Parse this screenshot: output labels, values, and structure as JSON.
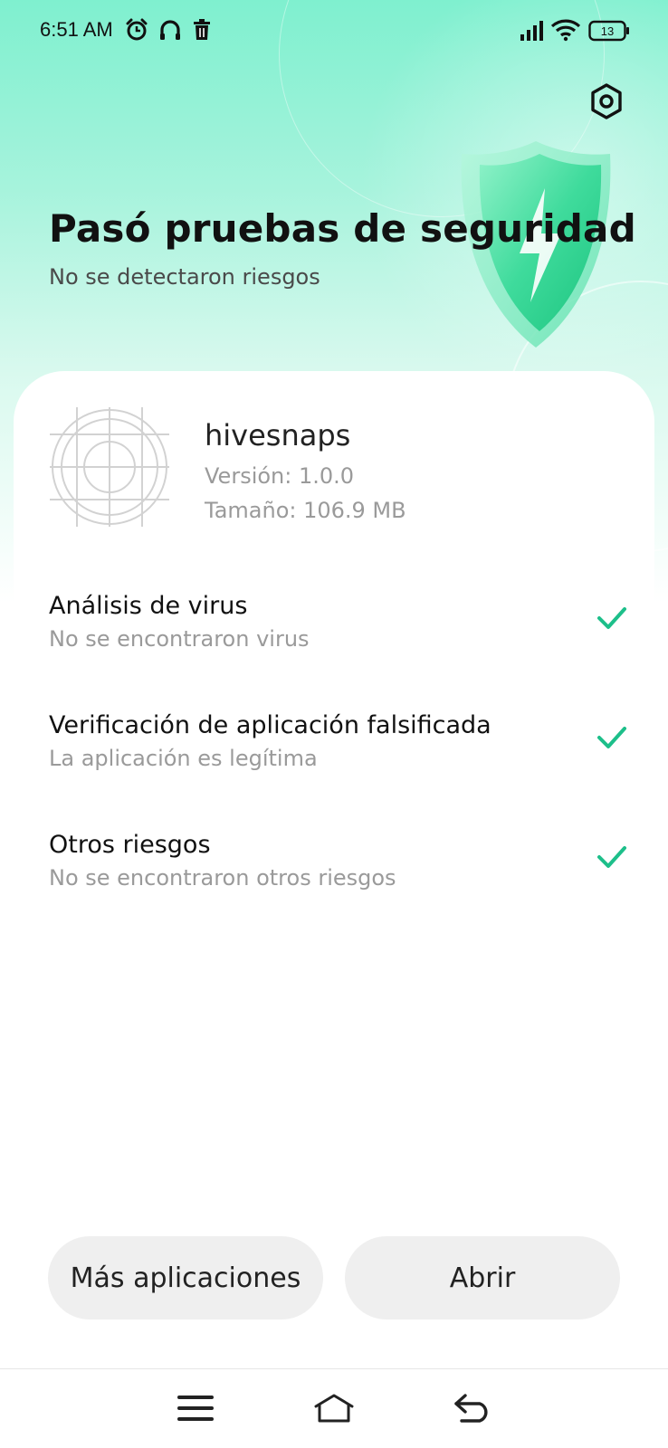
{
  "status_bar": {
    "time": "6:51 AM",
    "left_icons": [
      "alarm-icon",
      "headphones-icon",
      "trash-icon"
    ],
    "right_icons": [
      "signal-icon",
      "wifi-icon",
      "battery-icon"
    ],
    "battery_level": "13"
  },
  "header": {
    "title": "Pasó pruebas de seguridad",
    "subtitle": "No se detectaron riesgos",
    "settings_icon": "settings-hexagon-icon",
    "illustration_icon": "shield-icon"
  },
  "app": {
    "icon": "app-placeholder-icon",
    "name": "hivesnaps",
    "version": "Versión: 1.0.0",
    "size": "Tamaño: 106.9 MB"
  },
  "checks": [
    {
      "title": "Análisis de virus",
      "description": "No se encontraron virus",
      "status_icon": "check-icon"
    },
    {
      "title": "Verificación de aplicación falsificada",
      "description": "La aplicación es legítima",
      "status_icon": "check-icon"
    },
    {
      "title": "Otros riesgos",
      "description": "No se encontraron otros riesgos",
      "status_icon": "check-icon"
    }
  ],
  "actions": {
    "more_apps_label": "Más aplicaciones",
    "open_label": "Abrir"
  },
  "nav": {
    "icons": [
      "menu-icon",
      "home-icon",
      "back-icon"
    ]
  },
  "colors": {
    "accent": "#1dbf8a",
    "hero_top": "#7ff0cf",
    "button_bg": "#efefef"
  }
}
